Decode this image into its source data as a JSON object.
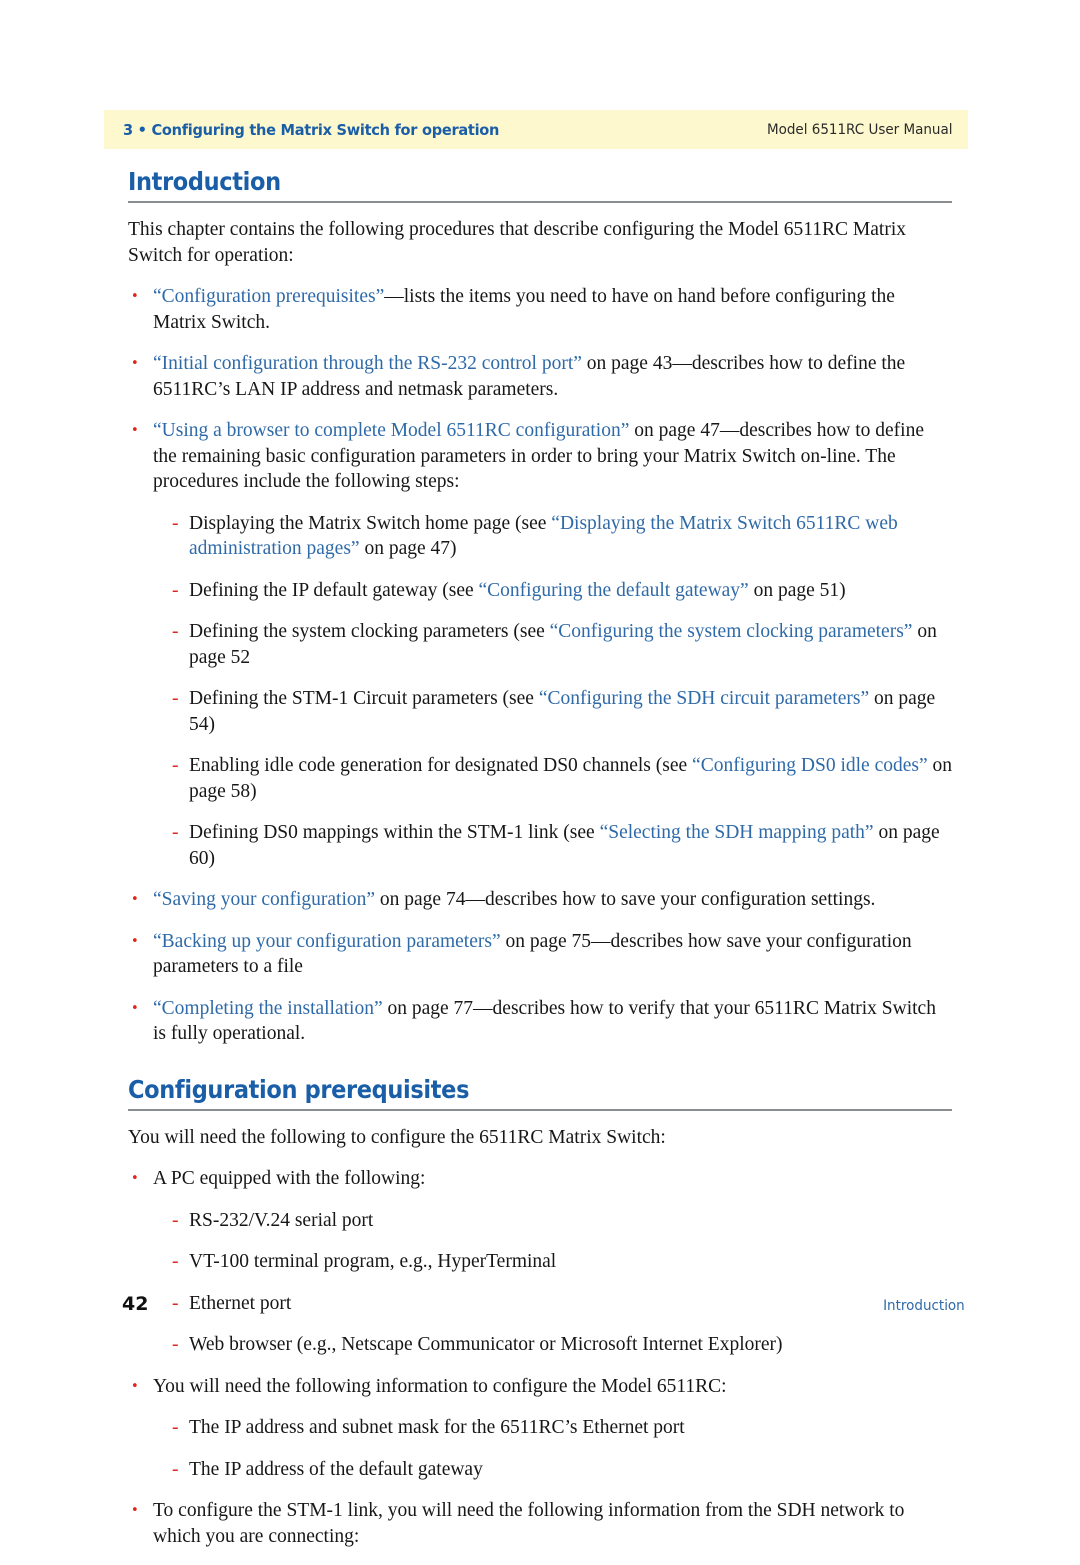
{
  "colors": {
    "heading_blue": "#1a5ea8",
    "link_blue": "#2f6aa8",
    "bullet_red": "#e2231a",
    "header_band": "#fdf8cd",
    "rule_gray": "#8a8d90",
    "body_text": "#171717"
  },
  "header": {
    "chapter": "3 • Configuring the Matrix Switch for operation",
    "manual": "Model 6511RC User Manual"
  },
  "sections": {
    "introduction": {
      "heading": "Introduction",
      "intro_paragraph": "This chapter contains the following procedures that describe configuring the Model 6511RC Matrix Switch for operation:",
      "bullets": [
        {
          "marker": "•",
          "link": "“Configuration prerequisites”",
          "rest": "—lists the items you need to have on hand before configuring the Matrix Switch."
        },
        {
          "marker": "•",
          "link": "“Initial configuration through the RS-232 control port”",
          "rest": " on page 43—describes how to define the 6511RC’s LAN IP address and netmask parameters."
        },
        {
          "marker": "•",
          "link": "“Using a browser to complete Model 6511RC configuration”",
          "rest": " on page 47—describes how to define the remaining basic configuration parameters in order to bring your Matrix Switch on-line. The procedures include the following steps:"
        }
      ],
      "sub_steps": [
        {
          "marker": "-",
          "before": "Displaying the Matrix Switch home page (see ",
          "link": "“Displaying the Matrix Switch 6511RC web administration pages”",
          "after": " on page 47)"
        },
        {
          "marker": "-",
          "before": "Defining the IP default gateway (see ",
          "link": "“Configuring the default gateway”",
          "after": " on page 51)"
        },
        {
          "marker": "-",
          "before": "Defining the system clocking parameters (see ",
          "link": "“Configuring the system clocking parameters”",
          "after": " on page 52"
        },
        {
          "marker": "-",
          "before": "Defining the STM-1 Circuit parameters (see ",
          "link": "“Configuring the SDH circuit parameters”",
          "after": " on page 54)"
        },
        {
          "marker": "-",
          "before": "Enabling idle code generation for designated DS0 channels (see ",
          "link": "“Configuring DS0 idle codes”",
          "after": " on page 58)"
        },
        {
          "marker": "-",
          "before": "Defining DS0 mappings within the STM-1 link (see ",
          "link": "“Selecting the SDH mapping path”",
          "after": " on page 60)"
        }
      ],
      "bullets_after": [
        {
          "marker": "•",
          "link": "“Saving your configuration”",
          "rest": " on page 74—describes how to save your configuration settings."
        },
        {
          "marker": "•",
          "link": "“Backing up your configuration parameters”",
          "rest": " on page 75—describes how save your configuration parameters to a file"
        },
        {
          "marker": "•",
          "link": "“Completing the installation”",
          "rest": " on page 77—describes how to verify that your 6511RC Matrix Switch is fully operational."
        }
      ]
    },
    "prerequisites": {
      "heading": "Configuration prerequisites",
      "intro_paragraph": "You will need the following to configure the 6511RC Matrix Switch:",
      "items": [
        {
          "marker": "•",
          "text": "A PC equipped with the following:",
          "sub": [
            {
              "marker": "-",
              "text": "RS-232/V.24 serial port"
            },
            {
              "marker": "-",
              "text": "VT-100 terminal program, e.g., HyperTerminal"
            },
            {
              "marker": "-",
              "text": "Ethernet port"
            },
            {
              "marker": "-",
              "text": "Web browser (e.g., Netscape Communicator or Microsoft Internet Explorer)"
            }
          ]
        },
        {
          "marker": "•",
          "text": "You will need the following information to configure the Model 6511RC:",
          "sub": [
            {
              "marker": "-",
              "text": "The IP address and subnet mask for the 6511RC’s Ethernet port"
            },
            {
              "marker": "-",
              "text": "The IP address of the default gateway"
            }
          ]
        },
        {
          "marker": "•",
          "text": "To configure the STM-1 link, you will need the following information from the SDH network to which you are connecting:",
          "sub": []
        }
      ]
    }
  },
  "footer": {
    "page_number": "42",
    "label": "Introduction"
  }
}
